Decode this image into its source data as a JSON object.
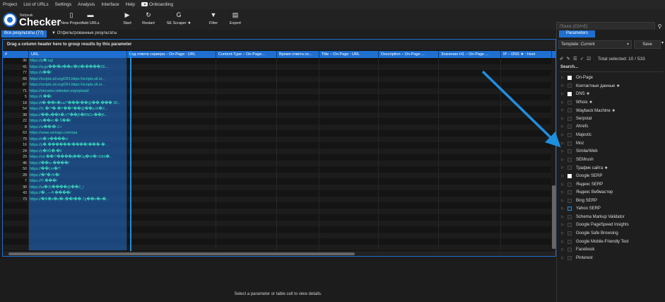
{
  "menubar": {
    "items": [
      "Project",
      "List of URLs",
      "Settings",
      "Analysis",
      "Interface",
      "Help",
      "Onboarding"
    ]
  },
  "logo": {
    "small": "Netpeak",
    "big": "Checker"
  },
  "toolbar": {
    "buttons": [
      {
        "icon": "page-icon",
        "glyph": "▯",
        "label": "New Project"
      },
      {
        "icon": "folder-icon",
        "glyph": "▬",
        "label": "Add URLs"
      },
      {
        "icon": "play-icon",
        "glyph": "▶",
        "label": "Start"
      },
      {
        "icon": "restart-icon",
        "glyph": "↻",
        "label": "Restart"
      },
      {
        "icon": "google-icon",
        "glyph": "G",
        "label": "SE Scraper ★"
      },
      {
        "icon": "filter-icon",
        "glyph": "▼",
        "label": "Filter"
      },
      {
        "icon": "export-icon",
        "glyph": "▤",
        "label": "Export"
      }
    ],
    "search_placeholder": "Поиск (Ctrl+E)"
  },
  "tabs": {
    "all_results": "Все результаты (77)",
    "filtered": "Отфильтрованные результаты"
  },
  "grid": {
    "group_hint": "Drag a column header here to group results by this parameter",
    "columns": [
      "#",
      "URL",
      "Код ответа сервера – On-Page : URL",
      "Content-Type – On-Page...",
      "Время ответа се...",
      "Title – On-Page : URL",
      "Description – On-Page ...",
      "Значение H1 – On-Page ...",
      "IP – DNS ★ : Host"
    ],
    "rows": [
      {
        "n": "36",
        "url": "https://p�.eg/"
      },
      {
        "n": "41",
        "url": "https://q.go��f�d��z/�M�i����ZE..."
      },
      {
        "n": "77",
        "url": "https://s��/"
      },
      {
        "n": "65",
        "url": "https://scripts.sil.org/OFLhttps://scripts.sil.or..."
      },
      {
        "n": "67",
        "url": "https://scripts.sil.org/OFLhttps://scripts.sil.or..."
      },
      {
        "n": "71",
        "url": "https://streams.videolan.org/upload/"
      },
      {
        "n": "5",
        "url": "https://t.��/"
      },
      {
        "n": "18",
        "url": "https://t�-��h�ca/?���!��@��-��� 39..."
      },
      {
        "n": "54",
        "url": "https://t1.�/?�-�Y��?��@��p.M�2..."
      },
      {
        "n": "38",
        "url": "https://��u��6�.r/?��j5�BNCc��j6..."
      },
      {
        "n": "22",
        "url": "https://v��et.�-Š��/"
      },
      {
        "n": "8",
        "url": "https://w��i�-2-/"
      },
      {
        "n": "63",
        "url": "https://www.verisign.com/rpa"
      },
      {
        "n": "70",
        "url": "https://x�.h����s/"
      },
      {
        "n": "16",
        "url": "https://y�.������/����)���-�..."
      },
      {
        "n": "24",
        "url": "https://y�9Ŝ�.�l/"
      },
      {
        "n": "29",
        "url": "https://zd.��/?����j��Dg�W�>D8d�..."
      },
      {
        "n": "46",
        "url": "https://��rz.����/"
      },
      {
        "n": "50",
        "url": "https://��Lm�/?"
      },
      {
        "n": "28",
        "url": "https://�?�.lK�/"
      },
      {
        "n": "7",
        "url": "https://⁉.���/"
      },
      {
        "n": "30",
        "url": "https://ш�J5����@��2_/"
      },
      {
        "n": "43",
        "url": "https://�...—ff.����/"
      },
      {
        "n": "73",
        "url": "https://�ffi�d�s�c��f��.7g��n�n�..."
      }
    ]
  },
  "details": {
    "hint": "Select a parameter or table cell to view details."
  },
  "panel": {
    "tab": "Parameters",
    "template_label": "Template: Current",
    "save": "Save",
    "total_selected": "Total selected: 10 / 533",
    "search_label": "Search...",
    "items": [
      {
        "label": "On-Page",
        "state": "full"
      },
      {
        "label": "Контактные данные ★",
        "state": "empty"
      },
      {
        "label": "DNS ★",
        "state": "full"
      },
      {
        "label": "Whois ★",
        "state": "empty"
      },
      {
        "label": "Wayback Machine ★",
        "state": "empty"
      },
      {
        "label": "Serpstat",
        "state": "empty"
      },
      {
        "label": "Ahrefs",
        "state": "empty"
      },
      {
        "label": "Majestic",
        "state": "empty"
      },
      {
        "label": "Moz",
        "state": "empty"
      },
      {
        "label": "SimilarWeb",
        "state": "empty"
      },
      {
        "label": "SEMrush",
        "state": "empty"
      },
      {
        "label": "Трафик сайта ★",
        "state": "empty"
      },
      {
        "label": "Google SERP",
        "state": "full"
      },
      {
        "label": "Яндекс SERP",
        "state": "empty"
      },
      {
        "label": "Яндекс Вебмастер",
        "state": "empty"
      },
      {
        "label": "Bing SERP",
        "state": "empty"
      },
      {
        "label": "Yahoo SERP",
        "state": "blue"
      },
      {
        "label": "Schema Markup Validator",
        "state": "empty"
      },
      {
        "label": "Google PageSpeed Insights",
        "state": "empty"
      },
      {
        "label": "Google Safe Browsing",
        "state": "empty"
      },
      {
        "label": "Google Mobile-Friendly Test",
        "state": "empty"
      },
      {
        "label": "Facebook",
        "state": "empty"
      },
      {
        "label": "Pinterest",
        "state": "empty"
      }
    ]
  },
  "colors": {
    "accent": "#1f6fd1",
    "url_text": "#3de0c0",
    "arrow": "#1f8fe0"
  }
}
